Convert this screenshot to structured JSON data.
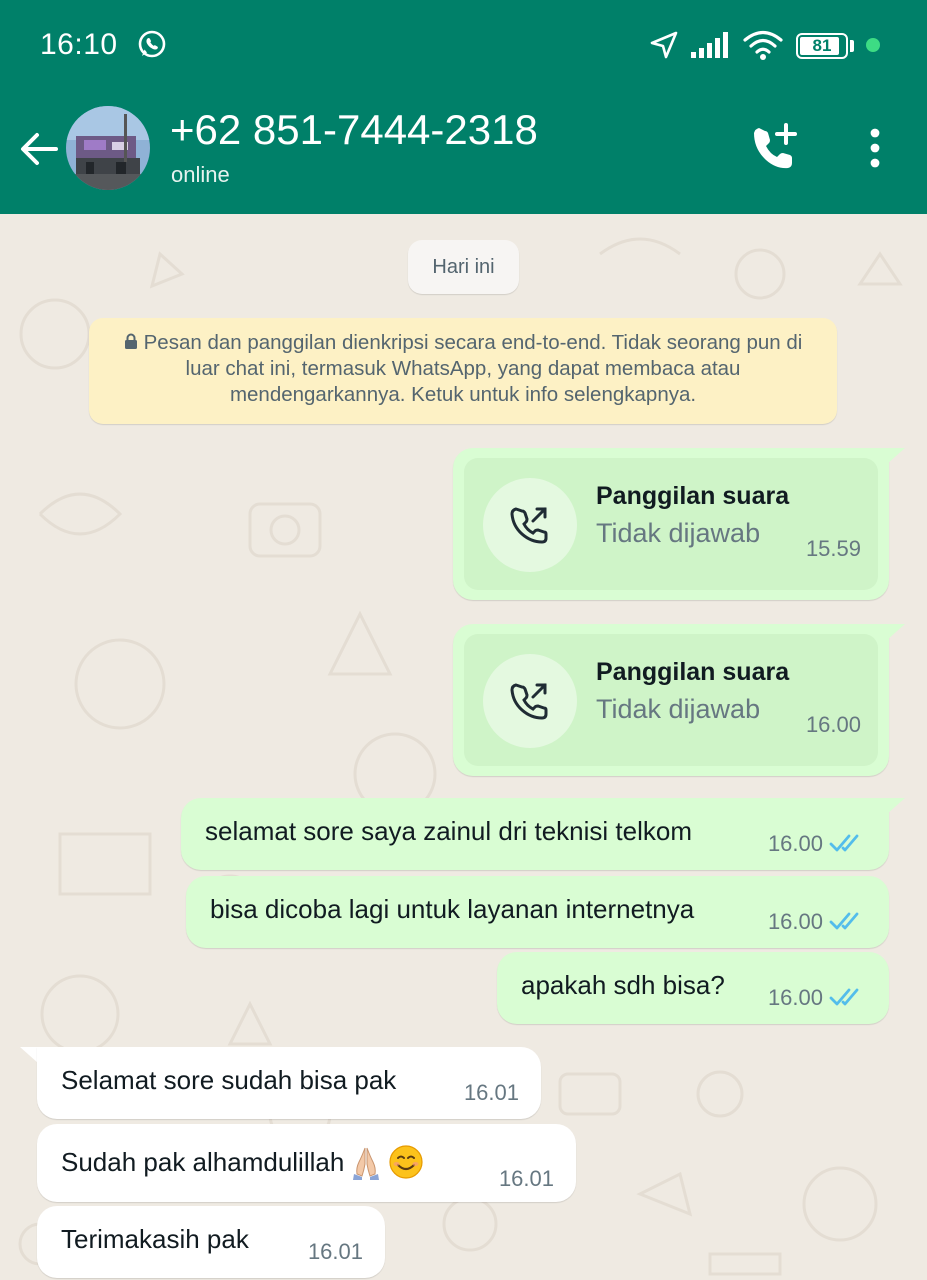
{
  "status_bar": {
    "time": "16:10",
    "battery_level": "81",
    "icons": [
      "whatsapp-icon",
      "location-icon",
      "signal-icon",
      "wifi-icon",
      "battery-icon"
    ]
  },
  "header": {
    "contact_name": "+62 851-7444-2318",
    "contact_status": "online",
    "icons": [
      "back-arrow-icon",
      "add-call-icon",
      "more-vert-icon"
    ]
  },
  "chat": {
    "date_chip": "Hari ini",
    "e2e_notice": "Pesan dan panggilan dienkripsi secara end-to-end. Tidak seorang pun di luar chat ini, termasuk WhatsApp, yang dapat membaca atau mendengarkannya. Ketuk untuk info selengkapnya.",
    "calls": [
      {
        "title": "Panggilan suara",
        "status": "Tidak dijawab",
        "time": "15.59"
      },
      {
        "title": "Panggilan suara",
        "status": "Tidak dijawab",
        "time": "16.00"
      }
    ],
    "outgoing": [
      {
        "text": "selamat sore saya zainul dri teknisi telkom",
        "time": "16.00",
        "status": "read"
      },
      {
        "text": "bisa dicoba lagi untuk layanan internetnya",
        "time": "16.00",
        "status": "read"
      },
      {
        "text": "apakah sdh bisa?",
        "time": "16.00",
        "status": "read"
      }
    ],
    "incoming": [
      {
        "text": "Selamat sore sudah bisa pak",
        "time": "16.01"
      },
      {
        "text": "Sudah pak alhamdulillah",
        "emoji": [
          "folded-hands",
          "smiling-face"
        ],
        "time": "16.01"
      },
      {
        "text": "Terimakasih pak",
        "time": "16.01"
      }
    ]
  },
  "colors": {
    "header": "#008069",
    "chat_background": "#efeae2",
    "outgoing_bubble": "#d9fdd3",
    "incoming_bubble": "#ffffff",
    "notice_background": "#fdf1c5",
    "read_ticks": "#53bdeb",
    "online_dot": "#3ddc84"
  }
}
